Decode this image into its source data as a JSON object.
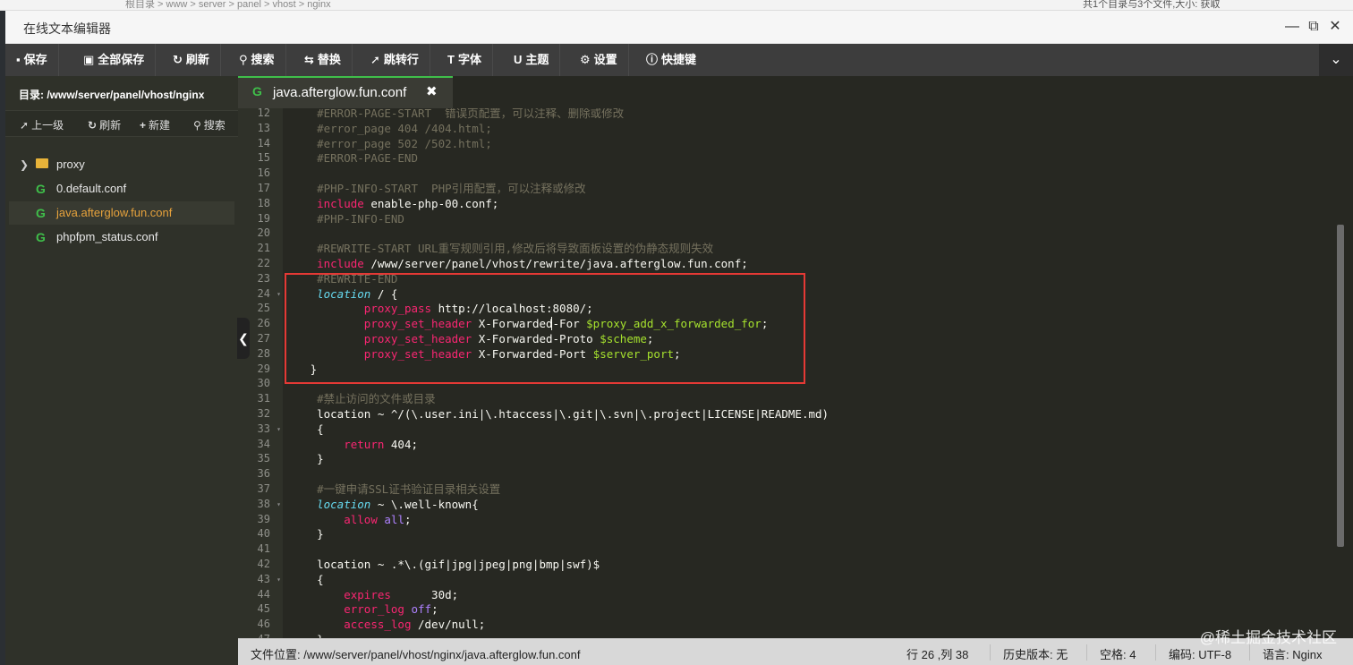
{
  "background": {
    "crumbs": "根目录  >  www  >  server  >  panel  >  vhost  >  nginx",
    "info": "共1个目录与3个文件,大小: 获取"
  },
  "window": {
    "title": "在线文本编辑器"
  },
  "toolbar": {
    "save": "保存",
    "save_all": "全部保存",
    "refresh": "刷新",
    "search": "搜索",
    "replace": "替换",
    "goto_line": "跳转行",
    "font": "字体",
    "theme": "主题",
    "settings": "设置",
    "shortcuts": "快捷键"
  },
  "sidebar": {
    "path": "目录: /www/server/panel/vhost/nginx",
    "tools": {
      "up": "上一级",
      "refresh": "刷新",
      "new": "新建",
      "search": "搜索"
    },
    "items": [
      {
        "label": "proxy"
      },
      {
        "label": "0.default.conf"
      },
      {
        "label": "java.afterglow.fun.conf"
      },
      {
        "label": "phpfpm_status.conf"
      }
    ]
  },
  "editor": {
    "tab": "java.afterglow.fun.conf",
    "lines": [
      {
        "n": "12",
        "fold": false,
        "segs": [
          [
            "c-comment",
            "    #ERROR-PAGE-START  错误页配置，可以注释、删除或修改"
          ]
        ]
      },
      {
        "n": "13",
        "fold": false,
        "segs": [
          [
            "c-comment",
            "    #error_page 404 /404.html;"
          ]
        ]
      },
      {
        "n": "14",
        "fold": false,
        "segs": [
          [
            "c-comment",
            "    #error_page 502 /502.html;"
          ]
        ]
      },
      {
        "n": "15",
        "fold": false,
        "segs": [
          [
            "c-comment",
            "    #ERROR-PAGE-END"
          ]
        ]
      },
      {
        "n": "16",
        "fold": false,
        "segs": [
          [
            "c-pl",
            ""
          ]
        ]
      },
      {
        "n": "17",
        "fold": false,
        "segs": [
          [
            "c-comment",
            "    #PHP-INFO-START  PHP引用配置，可以注释或修改"
          ]
        ]
      },
      {
        "n": "18",
        "fold": false,
        "segs": [
          [
            "c-pl",
            "    "
          ],
          [
            "c-kw",
            "include"
          ],
          [
            "c-pl",
            " enable-php-00.conf;"
          ]
        ]
      },
      {
        "n": "19",
        "fold": false,
        "segs": [
          [
            "c-comment",
            "    #PHP-INFO-END"
          ]
        ]
      },
      {
        "n": "20",
        "fold": false,
        "segs": [
          [
            "c-pl",
            ""
          ]
        ]
      },
      {
        "n": "21",
        "fold": false,
        "segs": [
          [
            "c-comment",
            "    #REWRITE-START URL重写规则引用,修改后将导致面板设置的伪静态规则失效"
          ]
        ]
      },
      {
        "n": "22",
        "fold": false,
        "segs": [
          [
            "c-pl",
            "    "
          ],
          [
            "c-kw",
            "include"
          ],
          [
            "c-pl",
            " /www/server/panel/vhost/rewrite/java.afterglow.fun.conf;"
          ]
        ]
      },
      {
        "n": "23",
        "fold": false,
        "segs": [
          [
            "c-comment",
            "    #REWRITE-END"
          ]
        ]
      },
      {
        "n": "24",
        "fold": true,
        "segs": [
          [
            "c-pl",
            "    "
          ],
          [
            "c-dir",
            "location"
          ],
          [
            "c-pl",
            " / {"
          ]
        ]
      },
      {
        "n": "25",
        "fold": false,
        "segs": [
          [
            "c-pl",
            "           "
          ],
          [
            "c-kw",
            "proxy_pass"
          ],
          [
            "c-pl",
            " http://localhost:8080/;"
          ]
        ]
      },
      {
        "n": "26",
        "fold": false,
        "segs": [
          [
            "c-pl",
            "           "
          ],
          [
            "c-kw",
            "proxy_set_header"
          ],
          [
            "c-pl",
            " X-Forwarded-For "
          ],
          [
            "c-var",
            "$proxy_add_x_forwarded_for"
          ],
          [
            "c-pl",
            ";"
          ]
        ]
      },
      {
        "n": "27",
        "fold": false,
        "segs": [
          [
            "c-pl",
            "           "
          ],
          [
            "c-kw",
            "proxy_set_header"
          ],
          [
            "c-pl",
            " X-Forwarded-Proto "
          ],
          [
            "c-var",
            "$scheme"
          ],
          [
            "c-pl",
            ";"
          ]
        ]
      },
      {
        "n": "28",
        "fold": false,
        "segs": [
          [
            "c-pl",
            "           "
          ],
          [
            "c-kw",
            "proxy_set_header"
          ],
          [
            "c-pl",
            " X-Forwarded-Port "
          ],
          [
            "c-var",
            "$server_port"
          ],
          [
            "c-pl",
            ";"
          ]
        ]
      },
      {
        "n": "29",
        "fold": false,
        "segs": [
          [
            "c-pl",
            "   }"
          ]
        ]
      },
      {
        "n": "30",
        "fold": false,
        "segs": [
          [
            "c-pl",
            ""
          ]
        ]
      },
      {
        "n": "31",
        "fold": false,
        "segs": [
          [
            "c-comment",
            "    #禁止访问的文件或目录"
          ]
        ]
      },
      {
        "n": "32",
        "fold": false,
        "segs": [
          [
            "c-pl",
            "    location ~ ^/(\\.user.ini|\\.htaccess|\\.git|\\.svn|\\.project|LICENSE|README.md)"
          ]
        ]
      },
      {
        "n": "33",
        "fold": true,
        "segs": [
          [
            "c-pl",
            "    {"
          ]
        ]
      },
      {
        "n": "34",
        "fold": false,
        "segs": [
          [
            "c-pl",
            "        "
          ],
          [
            "c-kw",
            "return"
          ],
          [
            "c-pl",
            " 404;"
          ]
        ]
      },
      {
        "n": "35",
        "fold": false,
        "segs": [
          [
            "c-pl",
            "    }"
          ]
        ]
      },
      {
        "n": "36",
        "fold": false,
        "segs": [
          [
            "c-pl",
            ""
          ]
        ]
      },
      {
        "n": "37",
        "fold": false,
        "segs": [
          [
            "c-comment",
            "    #一键申请SSL证书验证目录相关设置"
          ]
        ]
      },
      {
        "n": "38",
        "fold": true,
        "segs": [
          [
            "c-pl",
            "    "
          ],
          [
            "c-dir",
            "location"
          ],
          [
            "c-pl",
            " ~ \\.well-known{"
          ]
        ]
      },
      {
        "n": "39",
        "fold": false,
        "segs": [
          [
            "c-pl",
            "        "
          ],
          [
            "c-kw",
            "allow"
          ],
          [
            "c-pl",
            " "
          ],
          [
            "c-ae",
            "all"
          ],
          [
            "c-pl",
            ";"
          ]
        ]
      },
      {
        "n": "40",
        "fold": false,
        "segs": [
          [
            "c-pl",
            "    }"
          ]
        ]
      },
      {
        "n": "41",
        "fold": false,
        "segs": [
          [
            "c-pl",
            ""
          ]
        ]
      },
      {
        "n": "42",
        "fold": false,
        "segs": [
          [
            "c-pl",
            "    location ~ .*\\.(gif|jpg|jpeg|png|bmp|swf)$"
          ]
        ]
      },
      {
        "n": "43",
        "fold": true,
        "segs": [
          [
            "c-pl",
            "    {"
          ]
        ]
      },
      {
        "n": "44",
        "fold": false,
        "segs": [
          [
            "c-pl",
            "        "
          ],
          [
            "c-kw",
            "expires"
          ],
          [
            "c-pl",
            "      30d;"
          ]
        ]
      },
      {
        "n": "45",
        "fold": false,
        "segs": [
          [
            "c-pl",
            "        "
          ],
          [
            "c-kw",
            "error_log"
          ],
          [
            "c-pl",
            " "
          ],
          [
            "c-ae",
            "off"
          ],
          [
            "c-pl",
            ";"
          ]
        ]
      },
      {
        "n": "46",
        "fold": false,
        "segs": [
          [
            "c-pl",
            "        "
          ],
          [
            "c-kw",
            "access_log"
          ],
          [
            "c-pl",
            " /dev/null;"
          ]
        ]
      },
      {
        "n": "47",
        "fold": false,
        "segs": [
          [
            "c-pl",
            "    }"
          ]
        ]
      }
    ]
  },
  "status": {
    "file_location": "文件位置: /www/server/panel/vhost/nginx/java.afterglow.fun.conf",
    "cursor": "行 26 ,列 38",
    "history": "历史版本: 无",
    "spaces": "空格: 4",
    "encoding": "编码: UTF-8",
    "language": "语言: Nginx"
  },
  "watermark": "@稀土掘金技术社区",
  "colors": {
    "editor_bg": "#272822",
    "toolbar_bg": "#3d3d3d",
    "accent_green": "#3fbf4a",
    "active_file": "#e6a23c",
    "highlight_box": "#e53935"
  }
}
